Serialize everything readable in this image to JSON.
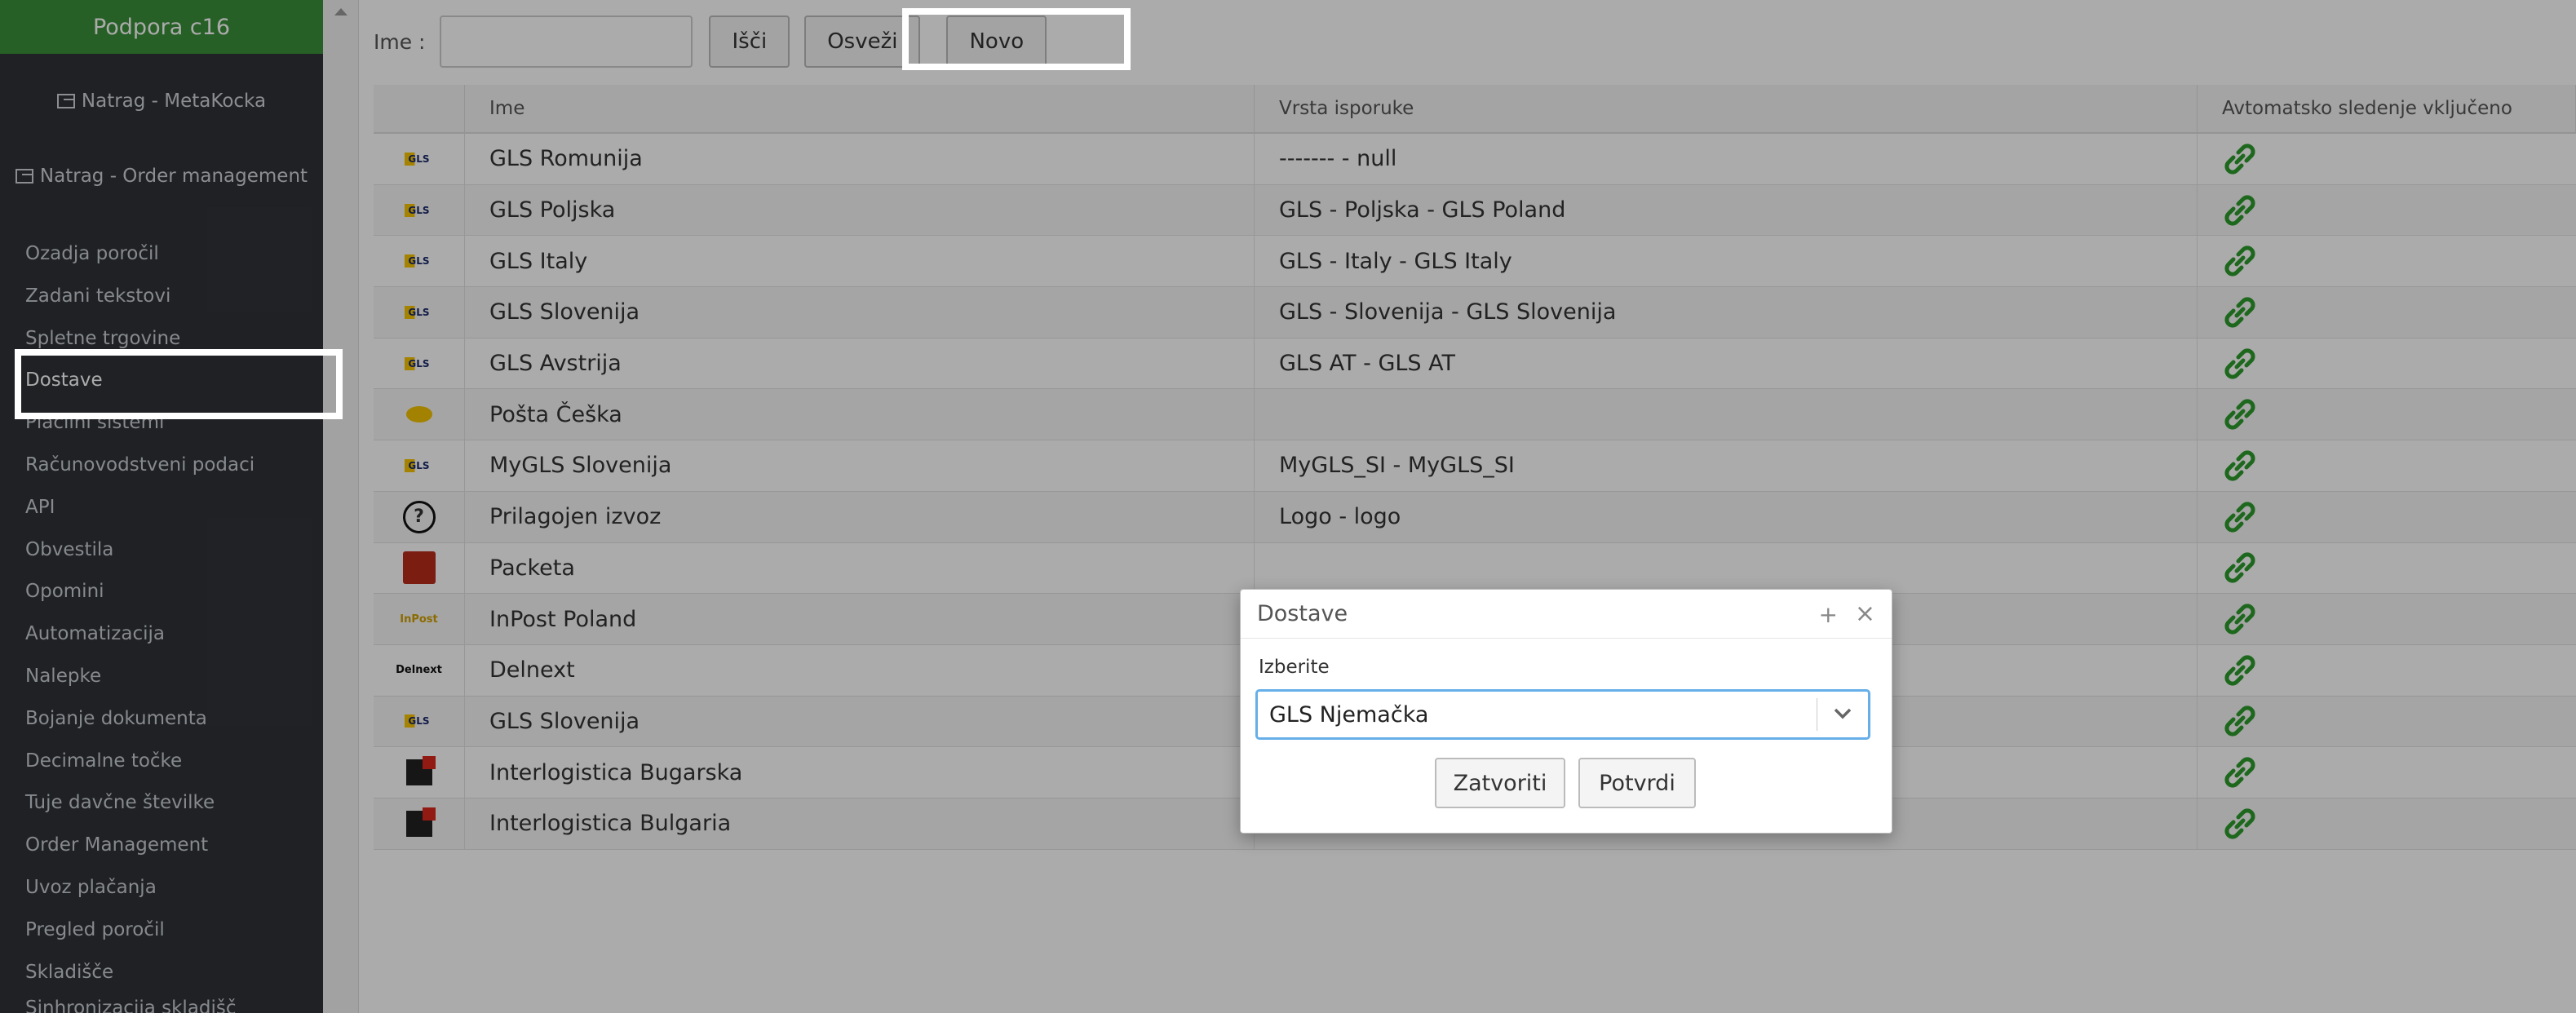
{
  "sidebar": {
    "header": "Podpora c16",
    "back_links": [
      "Natrag - MetaKocka",
      "Natrag - Order management"
    ],
    "items": [
      "Ozadja poročil",
      "Zadani tekstovi",
      "Spletne trgovine",
      "Dostave",
      "Plačilni sistemi",
      "Računovodstveni podaci",
      "API",
      "Obvestila",
      "Opomini",
      "Automatizacija",
      "Nalepke",
      "Bojanje dokumenta",
      "Decimalne točke",
      "Tuje davčne številke",
      "Order Management",
      "Uvoz plačanja",
      "Pregled poročil",
      "Skladišče",
      "Sinhronizacija skladišč"
    ]
  },
  "toolbar": {
    "name_label": "Ime :",
    "search_button": "Išči",
    "refresh_button": "Osveži",
    "new_button": "Novo"
  },
  "table": {
    "headers": {
      "name": "Ime",
      "delivery_type": "Vrsta isporuke",
      "auto_tracking": "Avtomatsko sledenje vključeno"
    },
    "rows": [
      {
        "logo": "GLS",
        "name": "GLS Romunija",
        "type": "------- - null"
      },
      {
        "logo": "GLS",
        "name": "GLS Poljska",
        "type": "GLS - Poljska - GLS Poland"
      },
      {
        "logo": "GLS",
        "name": "GLS Italy",
        "type": "GLS - Italy - GLS Italy"
      },
      {
        "logo": "GLS",
        "name": "GLS Slovenija",
        "type": "GLS - Slovenija - GLS Slovenija"
      },
      {
        "logo": "GLS",
        "name": "GLS Avstrija",
        "type": "GLS AT - GLS AT"
      },
      {
        "logo": "posta",
        "name": "Pošta Češka",
        "type": ""
      },
      {
        "logo": "GLS",
        "name": "MyGLS Slovenija",
        "type": "MyGLS_SI - MyGLS_SI"
      },
      {
        "logo": "question",
        "name": "Prilagojen izvoz",
        "type": "Logo - logo"
      },
      {
        "logo": "packeta",
        "name": "Packeta",
        "type": ""
      },
      {
        "logo": "inpost",
        "name": "InPost Poland",
        "type": ""
      },
      {
        "logo": "delnext",
        "name": "Delnext",
        "type": ""
      },
      {
        "logo": "GLS",
        "name": "GLS Slovenija",
        "type": ""
      },
      {
        "logo": "interlogistica",
        "name": "Interlogistica Bugarska",
        "type": ""
      },
      {
        "logo": "interlogistica",
        "name": "Interlogistica Bulgaria",
        "type": ""
      }
    ]
  },
  "dialog": {
    "title": "Dostave",
    "select_label": "Izberite",
    "selected_value": "GLS Njemačka",
    "cancel_button": "Zatvoriti",
    "confirm_button": "Potvrdi"
  },
  "logo_text": {
    "gls": "GLS",
    "question": "?",
    "inpost": "InPost",
    "delnext": "Delnext"
  },
  "colors": {
    "sidebar_bg": "#2f3237",
    "sidebar_header": "#3a8f3a",
    "link_icon": "#2e9b2e",
    "highlight_white": "#ffffff",
    "highlight_red": "#e8101c",
    "focus_border": "#66afe9"
  }
}
